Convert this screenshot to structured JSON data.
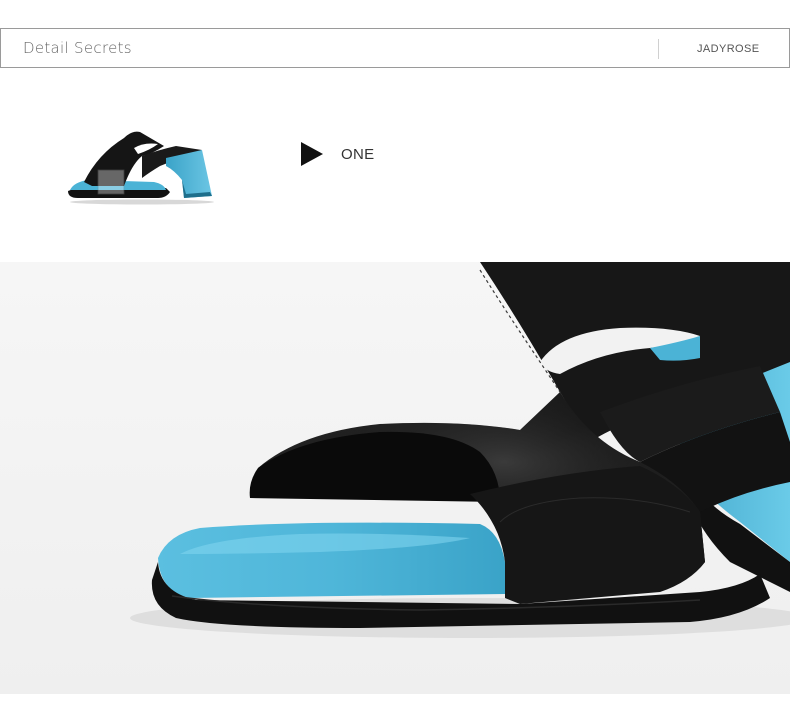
{
  "header": {
    "title": "Detail Secrets",
    "brand": "JADYROSE"
  },
  "detail": {
    "label": "ONE",
    "thumbnail_icon": "sandal-thumbnail-icon",
    "arrow_icon": "play-arrow-icon"
  },
  "colors": {
    "accent_blue": "#4bb3d6",
    "leather_black": "#141414",
    "background": "#f4f4f4"
  }
}
